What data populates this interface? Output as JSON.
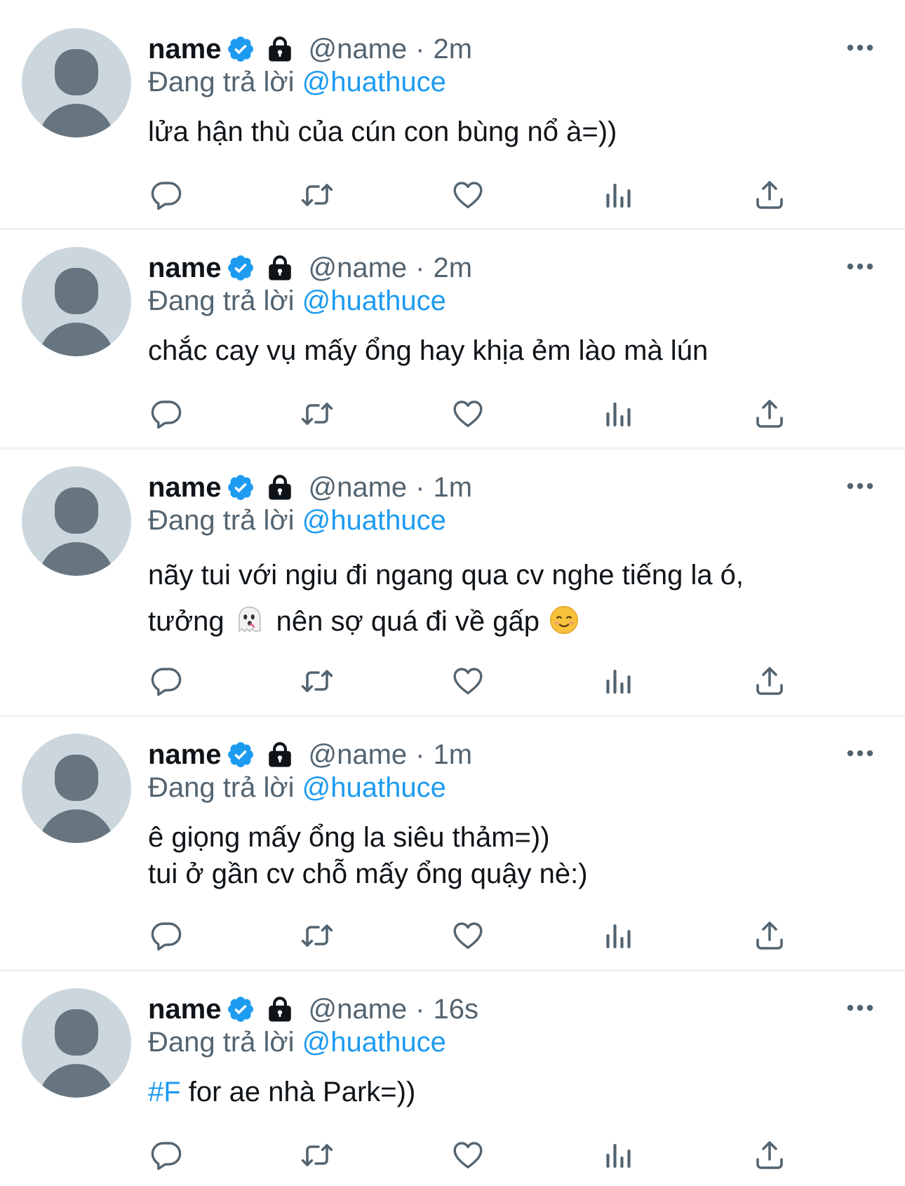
{
  "colors": {
    "accent": "#1d9bf0",
    "secondary_text": "#536471",
    "primary_text": "#0f1419",
    "divider": "#eff3f4",
    "avatar_bg": "#ccd6dd",
    "avatar_fg": "#66757f"
  },
  "icons": {
    "verified": "verified-badge-icon",
    "lock": "lock-icon",
    "more": "more-icon",
    "reply": "reply-icon",
    "retweet": "retweet-icon",
    "like": "like-icon",
    "views": "views-icon",
    "share": "share-icon"
  },
  "tweets": [
    {
      "author_name": "name",
      "handle": "@name",
      "separator": "·",
      "time": "2m",
      "replying_prefix": "Đang trả lời",
      "replying_to": "@huathuce",
      "lines": [
        "lửa hận thù của cún con bùng nổ à=))"
      ]
    },
    {
      "author_name": "name",
      "handle": "@name",
      "separator": "·",
      "time": "2m",
      "replying_prefix": "Đang trả lời",
      "replying_to": "@huathuce",
      "lines": [
        "chắc cay vụ mấy ổng hay khịa ẻm lào mà lún"
      ]
    },
    {
      "author_name": "name",
      "handle": "@name",
      "separator": "·",
      "time": "1m",
      "replying_prefix": "Đang trả lời",
      "replying_to": "@huathuce",
      "lines": [
        "nãy tui với ngiu đi ngang qua cv nghe tiếng la ó,"
      ],
      "line2_a": "tưởng",
      "line2_b": "nên sợ quá đi về gấp",
      "emojis": [
        "ghost-emoji",
        "smiling-face-emoji"
      ]
    },
    {
      "author_name": "name",
      "handle": "@name",
      "separator": "·",
      "time": "1m",
      "replying_prefix": "Đang trả lời",
      "replying_to": "@huathuce",
      "lines": [
        "ê giọng mấy ổng la siêu thảm=))",
        "tui ở gần cv chỗ mấy ổng quậy nè:)"
      ]
    },
    {
      "author_name": "name",
      "handle": "@name",
      "separator": "·",
      "time": "16s",
      "replying_prefix": "Đang trả lời",
      "replying_to": "@huathuce",
      "hashtag": "#F",
      "lines": [
        " for ae nhà Park=))"
      ]
    }
  ]
}
